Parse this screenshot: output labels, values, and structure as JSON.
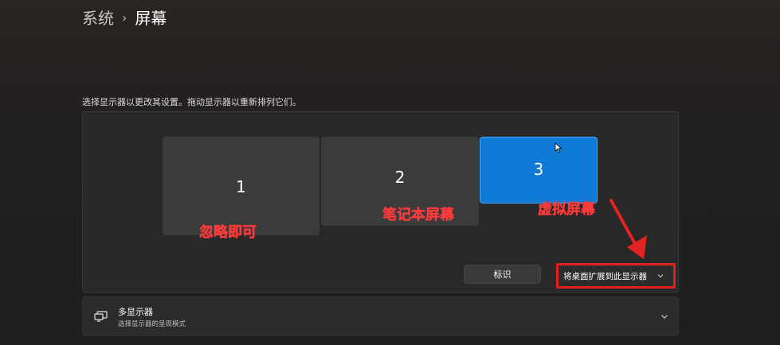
{
  "breadcrumb": {
    "parent": "系统",
    "separator": "›",
    "current": "屏幕"
  },
  "instruction": "选择显示器以更改其设置。拖动显示器以重新排列它们。",
  "monitors": [
    {
      "number": "1",
      "selected": false
    },
    {
      "number": "2",
      "selected": false
    },
    {
      "number": "3",
      "selected": true
    }
  ],
  "annotations": {
    "monitor1": "忽略即可",
    "monitor2": "笔记本屏幕",
    "monitor3": "虚拟屏幕"
  },
  "buttons": {
    "identify": "标识",
    "extend_dropdown": "将桌面扩展到此显示器"
  },
  "multi_display": {
    "title": "多显示器",
    "subtitle": "选择显示器的呈现模式"
  },
  "icons": {
    "breadcrumb_separator": "chevron-right-icon",
    "dropdown": "chevron-down-icon",
    "multi_display": "multi-monitor-icon",
    "expand": "chevron-down-icon",
    "cursor": "mouse-pointer-icon"
  },
  "colors": {
    "selected_monitor": "#0e7ad6",
    "annotation": "#ff3b3b",
    "highlight_border": "#e02020"
  }
}
